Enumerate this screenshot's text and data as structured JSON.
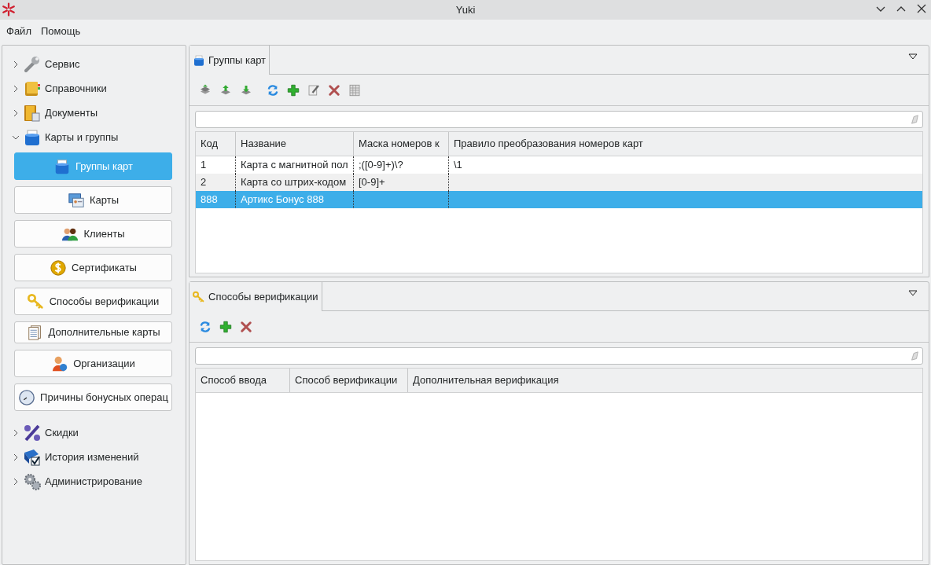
{
  "window": {
    "title": "Yuki"
  },
  "menu": [
    "Файл",
    "Помощь"
  ],
  "sidebar": {
    "items": [
      {
        "label": "Сервис",
        "expanded": false
      },
      {
        "label": "Справочники",
        "expanded": false
      },
      {
        "label": "Документы",
        "expanded": false
      },
      {
        "label": "Карты и группы",
        "expanded": true,
        "children": [
          {
            "label": "Группы карт",
            "selected": true
          },
          {
            "label": "Карты",
            "selected": false
          },
          {
            "label": "Клиенты",
            "selected": false
          },
          {
            "label": "Сертификаты",
            "selected": false
          },
          {
            "label": "Способы верификации",
            "selected": false
          },
          {
            "label": "Дополнительные карты",
            "selected": false
          },
          {
            "label": "Организации",
            "selected": false
          },
          {
            "label": "Причины бонусных операц",
            "selected": false
          }
        ]
      },
      {
        "label": "Скидки",
        "expanded": false
      },
      {
        "label": "История изменений",
        "expanded": false
      },
      {
        "label": "Администрирование",
        "expanded": false
      }
    ]
  },
  "panels": [
    {
      "tab": "Группы карт",
      "columns": [
        "Код",
        "Название",
        "Маска номеров к",
        "Правило преобразования номеров карт"
      ],
      "rows": [
        {
          "cells": [
            "1",
            "Карта с магнитной пол",
            ";([0-9]+)\\?",
            "\\1"
          ],
          "selected": false
        },
        {
          "cells": [
            "2",
            "Карта со штрих-кодом",
            "[0-9]+",
            ""
          ],
          "selected": false
        },
        {
          "cells": [
            "888",
            "Артикс Бонус 888",
            "",
            ""
          ],
          "selected": true
        }
      ]
    },
    {
      "tab": "Способы верификации",
      "columns": [
        "Способ ввода",
        "Способ верификации",
        "Дополнительная верификация"
      ]
    }
  ]
}
